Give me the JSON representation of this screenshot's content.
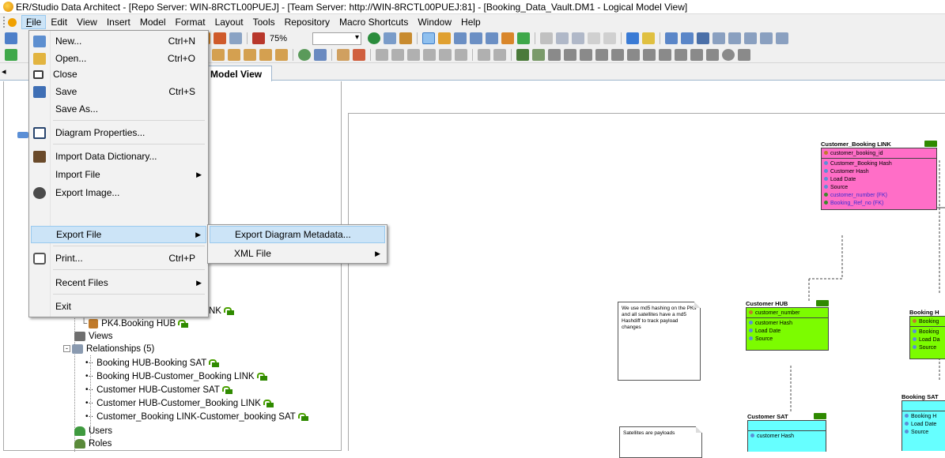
{
  "window": {
    "title": "ER/Studio Data Architect - [Repo Server: WIN-8RCTL00PUEJ] - [Team Server: http://WIN-8RCTL00PUEJ:81] - [Booking_Data_Vault.DM1 - Logical Model View]"
  },
  "menubar": {
    "items": [
      "File",
      "Edit",
      "View",
      "Insert",
      "Model",
      "Format",
      "Layout",
      "Tools",
      "Repository",
      "Macro Shortcuts",
      "Window",
      "Help"
    ]
  },
  "toolbar": {
    "zoom": "75%"
  },
  "tabs": {
    "left_arrow": "◂",
    "model_view": "Model View"
  },
  "file_menu": {
    "items": [
      {
        "label": "New...",
        "shortcut": "Ctrl+N",
        "icon": "new-file-icon"
      },
      {
        "label": "Open...",
        "shortcut": "Ctrl+O",
        "icon": "open-folder-icon"
      },
      {
        "label": "Close",
        "shortcut": "",
        "icon": "close-window-icon"
      },
      {
        "label": "Save",
        "shortcut": "Ctrl+S",
        "icon": "save-disk-icon"
      },
      {
        "label": "Save As...",
        "shortcut": "",
        "icon": ""
      },
      {
        "label": "Diagram Properties...",
        "shortcut": "",
        "icon": "properties-icon"
      },
      {
        "label": "Import Data Dictionary...",
        "shortcut": "",
        "icon": "dictionary-icon"
      },
      {
        "label": "Import File",
        "shortcut": "",
        "icon": ""
      },
      {
        "label": "Export Image...",
        "shortcut": "",
        "icon": "export-image-icon"
      },
      {
        "label": "Export File",
        "shortcut": "",
        "icon": ""
      },
      {
        "label": "Print...",
        "shortcut": "Ctrl+P",
        "icon": "printer-icon"
      },
      {
        "label": "Recent Files",
        "shortcut": "",
        "icon": ""
      },
      {
        "label": "Exit",
        "shortcut": "",
        "icon": ""
      }
    ]
  },
  "export_submenu": {
    "items": [
      {
        "label": "Export Diagram Metadata..."
      },
      {
        "label": "XML File"
      }
    ]
  },
  "tree": {
    "partial_link": "NK",
    "pk4": "PK4.Booking HUB",
    "views": "Views",
    "relationships": "Relationships (5)",
    "relationship_items": [
      "Booking HUB-Booking SAT",
      "Booking HUB-Customer_Booking LINK",
      "Customer HUB-Customer SAT",
      "Customer HUB-Customer_Booking LINK",
      "Customer_Booking LINK-Customer_booking SAT"
    ],
    "users": "Users",
    "roles": "Roles"
  },
  "diagram": {
    "customer_booking_link": {
      "title": "Customer_Booking LINK",
      "pk": "customer_booking_id",
      "attrs": [
        "Customer_Booking Hash",
        "Customer Hash",
        "Load Date",
        "Source"
      ],
      "fks": [
        "customer_number (FK)",
        "Booking_Ref_no (FK)"
      ],
      "color": "#ff6ec7"
    },
    "customer_hub": {
      "title": "Customer HUB",
      "pk": "customer_number",
      "attrs": [
        "customer Hash",
        "Load Date",
        "Source"
      ],
      "color": "#7cfc00"
    },
    "booking_hub": {
      "title": "Booking H",
      "pk": "Booking",
      "attrs": [
        "Booking",
        "Load Da",
        "Source"
      ],
      "color": "#7cfc00"
    },
    "customer_sat": {
      "title": "Customer SAT",
      "attrs": [
        "customer Hash"
      ],
      "color": "#66ffff"
    },
    "booking_sat": {
      "title": "Booking SAT",
      "attrs": [
        "Booking H",
        "Load Date",
        "Source"
      ],
      "color": "#66ffff"
    },
    "note1": "We use md5 hashing on the PKs and all satellites have a md5 Hashdiff to track payload changes",
    "note2": "Satellites are payloads"
  }
}
